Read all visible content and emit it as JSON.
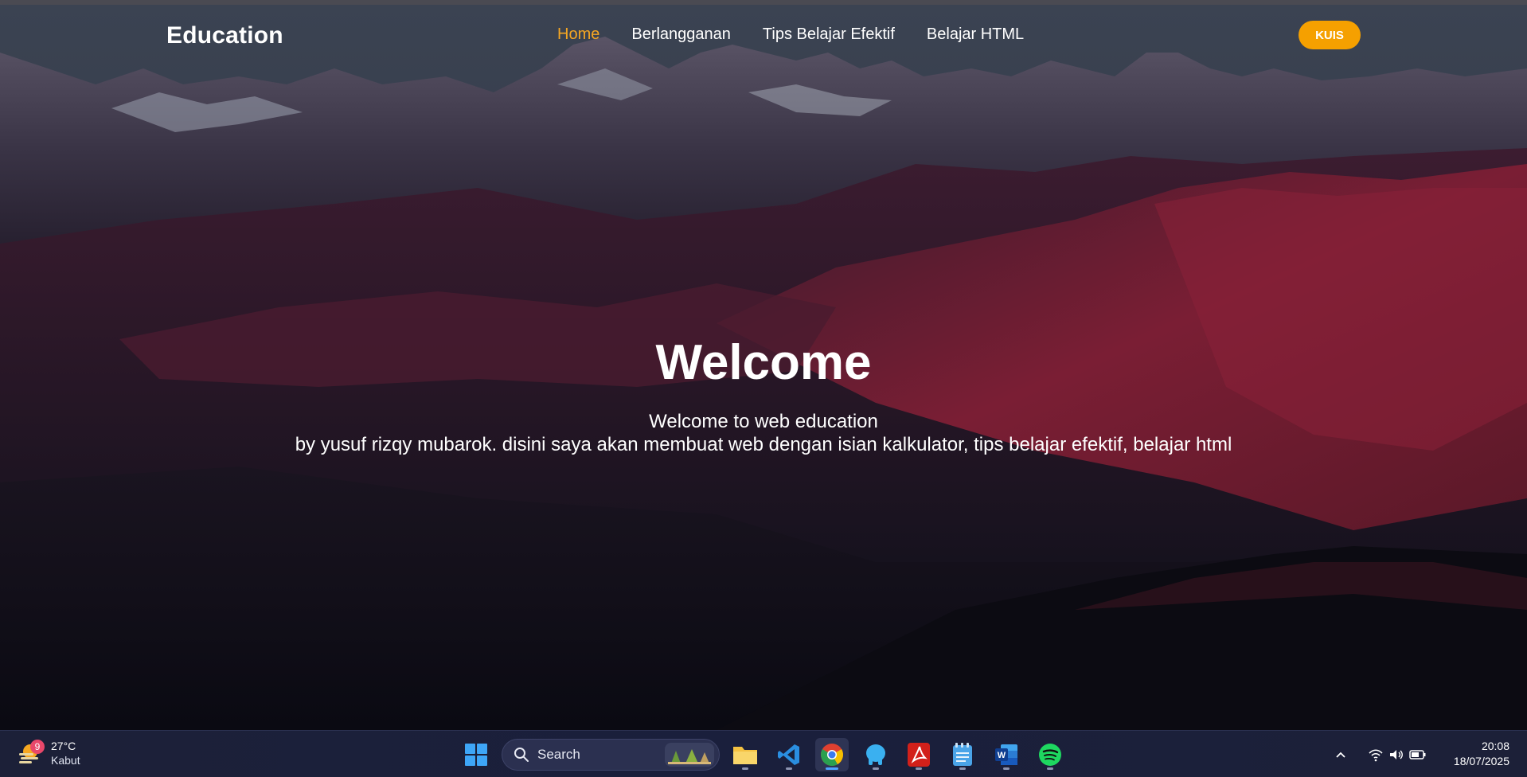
{
  "site": {
    "brand": "Education",
    "nav": [
      {
        "label": "Home",
        "active": true
      },
      {
        "label": "Berlangganan",
        "active": false
      },
      {
        "label": "Tips Belajar Efektif",
        "active": false
      },
      {
        "label": "Belajar HTML",
        "active": false
      }
    ],
    "cta_label": "KUIS",
    "accent": "#f5a000"
  },
  "hero": {
    "title": "Welcome",
    "line1": "Welcome to web education",
    "line2": "by yusuf rizqy mubarok. disini saya akan membuat web dengan isian kalkulator, tips belajar efektif, belajar html"
  },
  "taskbar": {
    "weather": {
      "temp": "27°C",
      "desc": "Kabut",
      "badge": "9"
    },
    "search_placeholder": "Search",
    "apps": [
      "file-explorer",
      "vscode",
      "chrome",
      "app-blue",
      "acrobat",
      "notepad",
      "word",
      "spotify"
    ],
    "time": "20:08",
    "date": "18/07/2025"
  }
}
